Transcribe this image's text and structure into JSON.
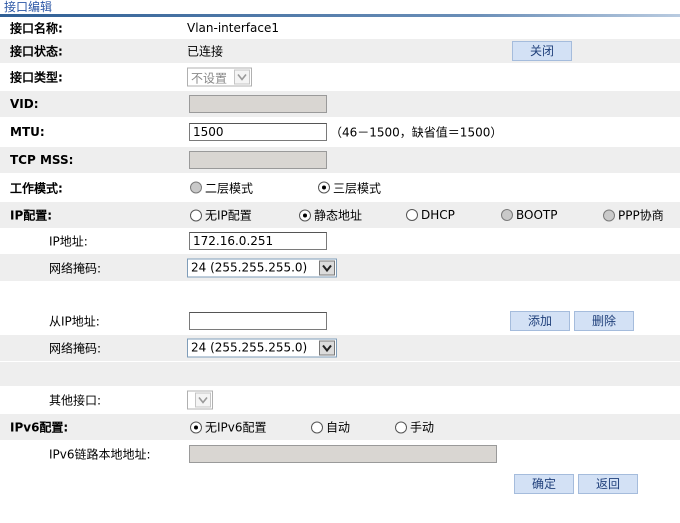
{
  "header": {
    "title": "接口编辑"
  },
  "colors": {
    "shade": "#eeeeee",
    "button_bg": "#d3e1f5",
    "header_line": "#2f5f95"
  },
  "interface_name": {
    "label": "接口名称:",
    "value": "Vlan-interface1"
  },
  "interface_status": {
    "label": "接口状态:",
    "value": "已连接",
    "close_button": "关闭"
  },
  "interface_type": {
    "label": "接口类型:",
    "selected": "不设置"
  },
  "vid": {
    "label": "VID:",
    "value": ""
  },
  "mtu": {
    "label": "MTU:",
    "value": "1500",
    "hint": "（46－1500，缺省值＝1500）"
  },
  "tcp_mss": {
    "label": "TCP MSS:",
    "value": ""
  },
  "work_mode": {
    "label": "工作模式:",
    "options": [
      {
        "label": "二层模式",
        "checked": false,
        "disabled": true
      },
      {
        "label": "三层模式",
        "checked": true,
        "disabled": false
      }
    ]
  },
  "ip_config": {
    "label": "IP配置:",
    "options": [
      {
        "label": "无IP配置",
        "checked": false,
        "disabled": false
      },
      {
        "label": "静态地址",
        "checked": true,
        "disabled": false
      },
      {
        "label": "DHCP",
        "checked": false,
        "disabled": false
      },
      {
        "label": "BOOTP",
        "checked": false,
        "disabled": true
      },
      {
        "label": "PPP协商",
        "checked": false,
        "disabled": true
      }
    ]
  },
  "ip_address": {
    "label": "IP地址:",
    "value": "172.16.0.251"
  },
  "netmask": {
    "label": "网络掩码:",
    "selected": "24 (255.255.255.0)"
  },
  "secondary_ip": {
    "label": "从IP地址:",
    "value": "",
    "add_button": "添加",
    "delete_button": "删除"
  },
  "secondary_netmask": {
    "label": "网络掩码:",
    "selected": "24 (255.255.255.0)"
  },
  "other_interface": {
    "label": "其他接口:",
    "selected": ""
  },
  "ipv6_config": {
    "label": "IPv6配置:",
    "options": [
      {
        "label": "无IPv6配置",
        "checked": true,
        "disabled": false
      },
      {
        "label": "自动",
        "checked": false,
        "disabled": false
      },
      {
        "label": "手动",
        "checked": false,
        "disabled": false
      }
    ]
  },
  "ipv6_link_local": {
    "label": "IPv6链路本地地址:",
    "value": ""
  },
  "footer": {
    "ok_button": "确定",
    "back_button": "返回"
  }
}
